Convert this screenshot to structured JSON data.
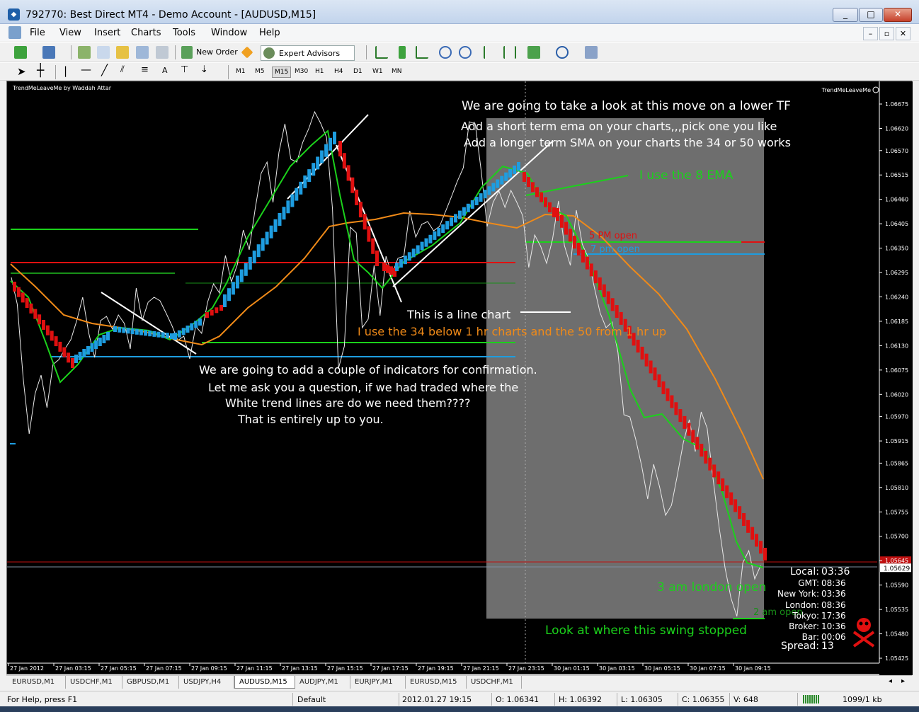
{
  "window": {
    "title": "792770: Best Direct MT4 - Demo Account - [AUDUSD,M15]",
    "min": "_",
    "max": "□",
    "close": "✕"
  },
  "menu": {
    "file": "File",
    "view": "View",
    "insert": "Insert",
    "charts": "Charts",
    "tools": "Tools",
    "window": "Window",
    "help": "Help"
  },
  "toolbar": {
    "new_order": "New Order",
    "expert_advisors": "Expert Advisors"
  },
  "timeframes": [
    "M1",
    "M5",
    "M15",
    "M30",
    "H1",
    "H4",
    "D1",
    "W1",
    "MN"
  ],
  "timeframe_active": "M15",
  "chart": {
    "indicator_label": "TrendMeLeaveMe by Waddah Attar",
    "indicator_label_right": "TrendMeLeaveMe",
    "price_labels": [
      "1.06675",
      "1.06620",
      "1.06570",
      "1.06515",
      "1.06460",
      "1.06405",
      "1.06350",
      "1.06295",
      "1.06240",
      "1.06185",
      "1.06130",
      "1.06075",
      "1.06020",
      "1.05970",
      "1.05915",
      "1.05865",
      "1.05810",
      "1.05755",
      "1.05700",
      "1.05645",
      "1.05629",
      "1.05590",
      "1.05535",
      "1.05480",
      "1.05425"
    ],
    "time_labels": [
      "27 Jan 2012",
      "27 Jan 03:15",
      "27 Jan 05:15",
      "27 Jan 07:15",
      "27 Jan 09:15",
      "27 Jan 11:15",
      "27 Jan 13:15",
      "27 Jan 15:15",
      "27 Jan 17:15",
      "27 Jan 19:15",
      "27 Jan 21:15",
      "27 Jan 23:15",
      "30 Jan 01:15",
      "30 Jan 03:15",
      "30 Jan 05:15",
      "30 Jan 07:15",
      "30 Jan 09:15"
    ],
    "annotations": {
      "lower_tf": "We are going to take a look at this move on a lower TF",
      "short_ema": "Add a short term ema on your charts,,,pick one you like",
      "long_sma": "Add a longer term SMA on your charts the 34 or 50 works",
      "ema8": "I use the 8 EMA",
      "pm5": "5 PM open",
      "pm7": "7 pm open",
      "line_chart": "This is a line chart",
      "sma34": "I use the 34 below 1 hr charts and the 50 from 1 hr up",
      "indicators": "We are going to add a couple of indicators for confirmation.",
      "question": "Let me ask you a question, if we had traded where the",
      "white_lines": "White trend lines are do we need them????",
      "up_to_you": "That is entirely up to you.",
      "london": "3 am london open",
      "am2": "2 am open",
      "swing": "Look at where this swing stopped"
    },
    "clock": {
      "local_label": "Local:",
      "local": "03:36",
      "gmt_label": "GMT:",
      "gmt": "08:36",
      "newyork_label": "New York:",
      "newyork": "03:36",
      "london_label": "London:",
      "london": "08:36",
      "tokyo_label": "Tokyo:",
      "tokyo": "17:36",
      "broker_label": "Broker:",
      "broker": "10:36",
      "bar_label": "Bar:",
      "bar": "00:06",
      "spread_label": "Spread:",
      "spread": "13"
    },
    "colors": {
      "bull": "#1e9de0",
      "bear": "#e01010",
      "ema": "#1bd11b",
      "sma": "#f08a18",
      "shade": "#7a7a7a"
    }
  },
  "tabs": [
    "EURUSD,M1",
    "USDCHF,M1",
    "GBPUSD,M1",
    "USDJPY,H4",
    "AUDUSD,M15",
    "AUDJPY,M1",
    "EURJPY,M1",
    "EURUSD,M15",
    "USDCHF,M1"
  ],
  "tab_active": "AUDUSD,M15",
  "status": {
    "help": "For Help, press F1",
    "profile": "Default",
    "datetime": "2012.01.27 19:15",
    "open": "O: 1.06341",
    "high": "H: 1.06392",
    "low": "L: 1.06305",
    "close": "C: 1.06355",
    "volume": "V: 648",
    "traffic": "1099/1 kb"
  }
}
